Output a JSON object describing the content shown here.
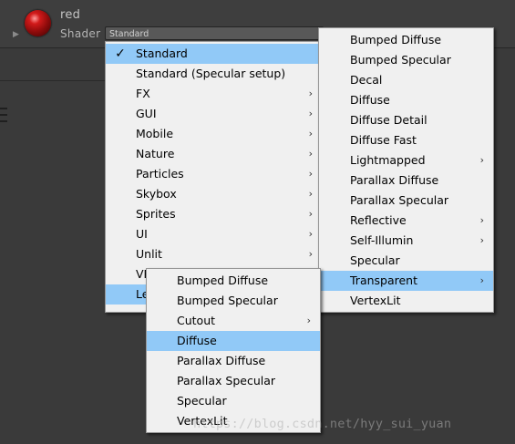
{
  "material": {
    "name": "red",
    "shader_label": "Shader",
    "shader_value": "Standard",
    "foldout_icon": "triangle-right-icon"
  },
  "main_menu": {
    "items": [
      {
        "label": "Standard",
        "checked": true,
        "submenu": false
      },
      {
        "label": "Standard (Specular setup)",
        "submenu": false
      },
      {
        "label": "FX",
        "submenu": true
      },
      {
        "label": "GUI",
        "submenu": true
      },
      {
        "label": "Mobile",
        "submenu": true
      },
      {
        "label": "Nature",
        "submenu": true
      },
      {
        "label": "Particles",
        "submenu": true
      },
      {
        "label": "Skybox",
        "submenu": true
      },
      {
        "label": "Sprites",
        "submenu": true
      },
      {
        "label": "UI",
        "submenu": true
      },
      {
        "label": "Unlit",
        "submenu": true
      },
      {
        "label": "VR",
        "submenu": true
      },
      {
        "label": "Legacy Shaders",
        "submenu": true,
        "highlighted": true
      }
    ]
  },
  "legacy_menu": {
    "items": [
      {
        "label": "Bumped Diffuse",
        "submenu": false
      },
      {
        "label": "Bumped Specular",
        "submenu": false
      },
      {
        "label": "Decal",
        "submenu": false
      },
      {
        "label": "Diffuse",
        "submenu": false
      },
      {
        "label": "Diffuse Detail",
        "submenu": false
      },
      {
        "label": "Diffuse Fast",
        "submenu": false
      },
      {
        "label": "Lightmapped",
        "submenu": true
      },
      {
        "label": "Parallax Diffuse",
        "submenu": false
      },
      {
        "label": "Parallax Specular",
        "submenu": false
      },
      {
        "label": "Reflective",
        "submenu": true
      },
      {
        "label": "Self-Illumin",
        "submenu": true
      },
      {
        "label": "Specular",
        "submenu": false
      },
      {
        "label": "Transparent",
        "submenu": true,
        "highlighted": true
      },
      {
        "label": "VertexLit",
        "submenu": false
      }
    ]
  },
  "transparent_menu": {
    "items": [
      {
        "label": "Bumped Diffuse",
        "submenu": false
      },
      {
        "label": "Bumped Specular",
        "submenu": false
      },
      {
        "label": "Cutout",
        "submenu": true
      },
      {
        "label": "Diffuse",
        "submenu": false,
        "highlighted": true
      },
      {
        "label": "Parallax Diffuse",
        "submenu": false
      },
      {
        "label": "Parallax Specular",
        "submenu": false
      },
      {
        "label": "Specular",
        "submenu": false
      },
      {
        "label": "VertexLit",
        "submenu": false
      }
    ]
  },
  "glyphs": {
    "check": "✓",
    "submenu_arrow": "›"
  },
  "colors": {
    "highlight": "#91c9f7",
    "menu_bg": "#f0f0f0",
    "editor_bg": "#3a3a3a"
  },
  "watermark": "https://blog.csdn.net/hyy_sui_yuan"
}
